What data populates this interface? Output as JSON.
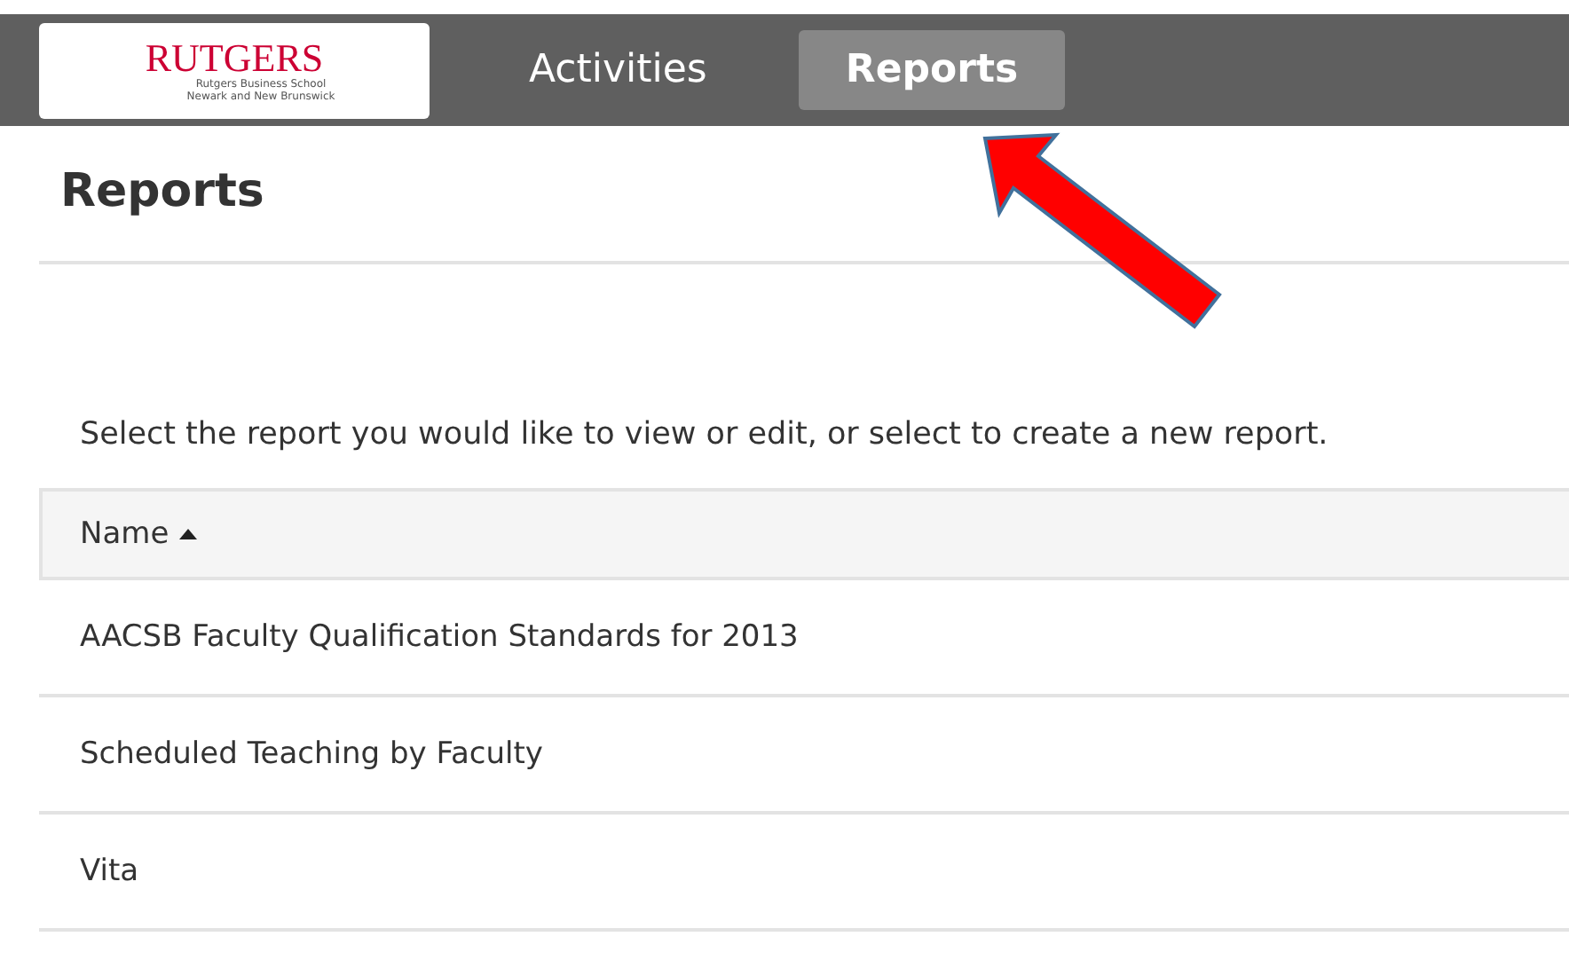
{
  "logo": {
    "wordmark": "RUTGERS",
    "line_1": "Rutgers Business School",
    "line_2": "Newark and New Brunswick"
  },
  "tabs": [
    {
      "label": "Activities",
      "selected": false
    },
    {
      "label": "Reports",
      "selected": true
    }
  ],
  "page_title": "Reports",
  "instructions": "Select the report you would like to view or edit, or select to create a new report.",
  "table": {
    "columns": [
      {
        "label": "Name",
        "sorted_ascending": true
      }
    ],
    "rows": [
      "AACSB Faculty Qualification Standards for 2013",
      "Scheduled Teaching by Faculty",
      "Vita"
    ]
  }
}
